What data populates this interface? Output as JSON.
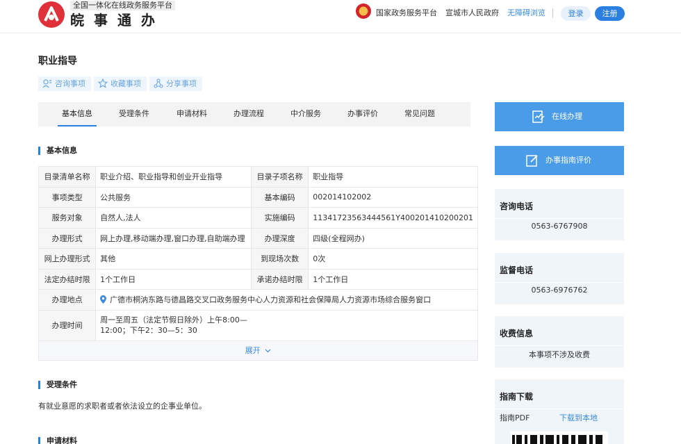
{
  "header": {
    "platform_tag": "全国一体化在线政务服务平台",
    "brand": "皖事通办",
    "links": {
      "national_platform": "国家政务服务平台",
      "city_gov": "宣城市人民政府",
      "accessibility": "无障碍浏览"
    },
    "login": "登录",
    "register": "注册"
  },
  "page": {
    "title": "职业指导",
    "actions": [
      "咨询事项",
      "收藏事项",
      "分享事项"
    ]
  },
  "tabs": [
    "基本信息",
    "受理条件",
    "申请材料",
    "办理流程",
    "中介服务",
    "办事评价",
    "常见问题"
  ],
  "basic_info": {
    "heading": "基本信息",
    "rows": [
      {
        "l1": "目录清单名称",
        "v1": "职业介绍、职业指导和创业开业指导",
        "l2": "目录子项名称",
        "v2": "职业指导"
      },
      {
        "l1": "事项类型",
        "v1": "公共服务",
        "l2": "基本编码",
        "v2": "002014102002"
      },
      {
        "l1": "服务对象",
        "v1": "自然人,法人",
        "l2": "实施编码",
        "v2": "11341723563444561Y400201410200201"
      },
      {
        "l1": "办理形式",
        "v1": "网上办理,移动端办理,窗口办理,自助端办理",
        "l2": "办理深度",
        "v2": "四级(全程网办)"
      },
      {
        "l1": "网上办理形式",
        "v1": "其他",
        "l2": "到现场次数",
        "v2": "0次"
      },
      {
        "l1": "法定办结时限",
        "v1": "1个工作日",
        "l2": "承诺办结时限",
        "v2": "1个工作日"
      }
    ],
    "address_label": "办理地点",
    "address": "广德市桐汭东路与德昌路交叉口政务服务中心人力资源和社会保障局人力资源市场综合服务窗口",
    "hours_label": "办理时间",
    "hours_line1": "周一至周五（法定节假日除外）上午8:00—",
    "hours_line2": "12:00；下午2：30—5：30",
    "expand": "展开"
  },
  "acceptance": {
    "heading": "受理条件",
    "text": "有就业意愿的求职者或者依法设立的企事业单位。"
  },
  "materials": {
    "heading": "申请材料"
  },
  "side": {
    "online_btn": "在线办理",
    "eval_btn": "办事指南评价",
    "consult": {
      "title": "咨询电话",
      "value": "0563-6767908"
    },
    "supervise": {
      "title": "监督电话",
      "value": "0563-6976762"
    },
    "fee": {
      "title": "收费信息",
      "value": "本事项不涉及收费"
    },
    "guide": {
      "title": "指南下载",
      "label": "指南PDF",
      "link": "下载到本地"
    }
  },
  "colors": {
    "accent": "#2b7fe0",
    "side_button": "#4a9be8",
    "logo": "#e0313a"
  }
}
